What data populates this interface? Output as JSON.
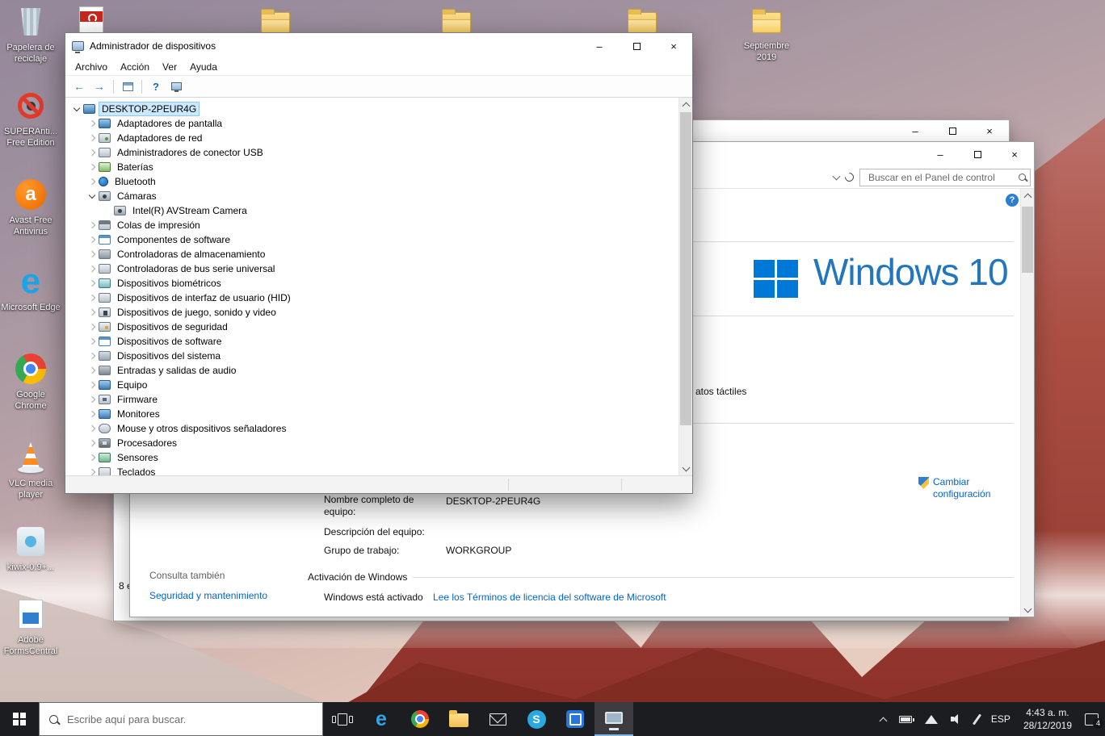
{
  "chrome": {
    "minimize": "–",
    "close": "×"
  },
  "desktop": {
    "top_shortcuts": [
      {
        "label": "",
        "icon": "di-pdf"
      },
      {
        "label": "",
        "icon": "di-fold"
      },
      {
        "label": "",
        "icon": "di-fold"
      },
      {
        "label": "",
        "icon": "di-fold"
      },
      {
        "label": "Septiembre 2019",
        "icon": "di-fold"
      }
    ],
    "left_shortcuts": [
      {
        "label": "Papelera de reciclaje",
        "icon": "di-recycle"
      },
      {
        "label": "SUPERAnti... Free Edition",
        "icon": "di-super"
      },
      {
        "label": "Avast Free Antivirus",
        "icon": "di-avast"
      },
      {
        "label": "Microsoft Edge",
        "icon": "di-edge"
      },
      {
        "label": "Google Chrome",
        "icon": "di-chrome"
      },
      {
        "label": "VLC media player",
        "icon": "di-vlc"
      },
      {
        "label": "kiwix-0.9+...",
        "icon": "di-kiwix"
      },
      {
        "label": "Adobe FormsCentral",
        "icon": "di-forms"
      }
    ]
  },
  "device_manager": {
    "title": "Administrador de dispositivos",
    "menu_items": [
      {
        "label": "Archivo"
      },
      {
        "label": "Acción"
      },
      {
        "label": "Ver"
      },
      {
        "label": "Ayuda"
      }
    ],
    "toolbar": {
      "back": "←",
      "forward": "→",
      "help": "?"
    },
    "tree_items": [
      {
        "label": "DESKTOP-2PEUR4G",
        "lvl": "lvl0",
        "chev": "chev-exp",
        "icon": "ti-pc",
        "selcls": "sel"
      },
      {
        "label": "Adaptadores de pantalla",
        "lvl": "lvl1",
        "chev": "chev-col",
        "icon": "ti-display",
        "selcls": ""
      },
      {
        "label": "Adaptadores de red",
        "lvl": "lvl1",
        "chev": "chev-col",
        "icon": "ti-net",
        "selcls": ""
      },
      {
        "label": "Administradores de conector USB",
        "lvl": "lvl1",
        "chev": "chev-col",
        "icon": "ti-usb",
        "selcls": ""
      },
      {
        "label": "Baterías",
        "lvl": "lvl1",
        "chev": "chev-col",
        "icon": "ti-batt",
        "selcls": ""
      },
      {
        "label": "Bluetooth",
        "lvl": "lvl1",
        "chev": "chev-col",
        "icon": "ti-bt",
        "selcls": ""
      },
      {
        "label": "Cámaras",
        "lvl": "lvl1",
        "chev": "chev-exp",
        "icon": "ti-cam",
        "selcls": ""
      },
      {
        "label": "Intel(R) AVStream Camera",
        "lvl": "lvl2",
        "chev": "chev-none",
        "icon": "ti-cam",
        "selcls": ""
      },
      {
        "label": "Colas de impresión",
        "lvl": "lvl1",
        "chev": "chev-col",
        "icon": "ti-print",
        "selcls": ""
      },
      {
        "label": "Componentes de software",
        "lvl": "lvl1",
        "chev": "chev-col",
        "icon": "ti-soft",
        "selcls": ""
      },
      {
        "label": "Controladoras de almacenamiento",
        "lvl": "lvl1",
        "chev": "chev-col",
        "icon": "ti-store",
        "selcls": ""
      },
      {
        "label": "Controladoras de bus serie universal",
        "lvl": "lvl1",
        "chev": "chev-col",
        "icon": "ti-usb",
        "selcls": ""
      },
      {
        "label": "Dispositivos biométricos",
        "lvl": "lvl1",
        "chev": "chev-col",
        "icon": "ti-bio",
        "selcls": ""
      },
      {
        "label": "Dispositivos de interfaz de usuario (HID)",
        "lvl": "lvl1",
        "chev": "chev-col",
        "icon": "ti-hid",
        "selcls": ""
      },
      {
        "label": "Dispositivos de juego, sonido y video",
        "lvl": "lvl1",
        "chev": "chev-col",
        "icon": "ti-sound",
        "selcls": ""
      },
      {
        "label": "Dispositivos de seguridad",
        "lvl": "lvl1",
        "chev": "chev-col",
        "icon": "ti-sec",
        "selcls": ""
      },
      {
        "label": "Dispositivos de software",
        "lvl": "lvl1",
        "chev": "chev-col",
        "icon": "ti-soft",
        "selcls": ""
      },
      {
        "label": "Dispositivos del sistema",
        "lvl": "lvl1",
        "chev": "chev-col",
        "icon": "ti-sys",
        "selcls": ""
      },
      {
        "label": "Entradas y salidas de audio",
        "lvl": "lvl1",
        "chev": "chev-col",
        "icon": "ti-audio",
        "selcls": ""
      },
      {
        "label": "Equipo",
        "lvl": "lvl1",
        "chev": "chev-col",
        "icon": "ti-pc2",
        "selcls": ""
      },
      {
        "label": "Firmware",
        "lvl": "lvl1",
        "chev": "chev-col",
        "icon": "ti-fw",
        "selcls": ""
      },
      {
        "label": "Monitores",
        "lvl": "lvl1",
        "chev": "chev-col",
        "icon": "ti-display",
        "selcls": ""
      },
      {
        "label": "Mouse y otros dispositivos señaladores",
        "lvl": "lvl1",
        "chev": "chev-col",
        "icon": "ti-mouse",
        "selcls": ""
      },
      {
        "label": "Procesadores",
        "lvl": "lvl1",
        "chev": "chev-col",
        "icon": "ti-cpu",
        "selcls": ""
      },
      {
        "label": "Sensores",
        "lvl": "lvl1",
        "chev": "chev-col",
        "icon": "ti-sensor",
        "selcls": ""
      },
      {
        "label": "Teclados",
        "lvl": "lvl1",
        "chev": "chev-col",
        "icon": "ti-kbd",
        "selcls": ""
      }
    ]
  },
  "system_window": {
    "search_placeholder": "Buscar en el Panel de control",
    "help": "?",
    "os_logo_text": "Windows 10",
    "touch_fragment": "atos táctiles",
    "change_settings": "Cambiar configuración",
    "computer_name_label": "Nombre completo de equipo:",
    "computer_name_value": "DESKTOP-2PEUR4G",
    "description_label": "Descripción del equipo:",
    "workgroup_label": "Grupo de trabajo:",
    "workgroup_value": "WORKGROUP",
    "see_also_heading": "Consulta también",
    "see_also_link": "Seguridad y mantenimiento",
    "activation_heading": "Activación de Windows",
    "activation_status": "Windows está activado",
    "license_link": "Lee los Términos de licencia del software de Microsoft",
    "back_window_fragment": "8 e"
  },
  "taskbar": {
    "search_placeholder": "Escribe aquí para buscar.",
    "language": "ESP",
    "time": "4:43 a. m.",
    "date": "28/12/2019",
    "notification_count": "4",
    "apps": [
      {
        "icon": "ai-edge",
        "slot": ""
      },
      {
        "icon": "ai-chrome",
        "slot": ""
      },
      {
        "icon": "ai-folder",
        "slot": ""
      },
      {
        "icon": "ai-mail",
        "slot": ""
      },
      {
        "icon": "ai-skype",
        "slot": ""
      },
      {
        "icon": "ai-blueapp",
        "slot": ""
      },
      {
        "icon": "ai-devmgr",
        "slot": "active"
      }
    ]
  }
}
